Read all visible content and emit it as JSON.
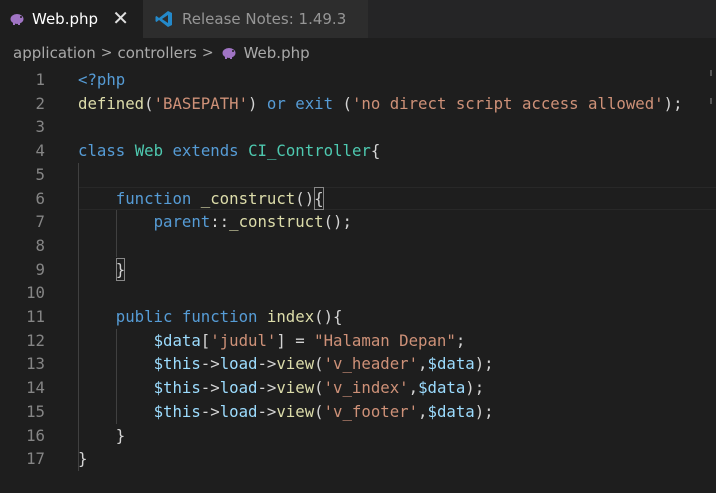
{
  "tabs": [
    {
      "label": "Web.php",
      "icon": "php-elephant-icon",
      "active": true
    },
    {
      "label": "Release Notes: 1.49.3",
      "icon": "vscode-icon",
      "active": false
    }
  ],
  "tab_close_glyph": "✕",
  "breadcrumb": {
    "items": [
      "application",
      "controllers"
    ],
    "separator": ">",
    "file": "Web.php",
    "file_icon": "php-elephant-icon"
  },
  "colors": {
    "background": "#1e1e1e",
    "keyword": "#569cd6",
    "function": "#dcdcaa",
    "string": "#ce9178",
    "class": "#4ec9b0",
    "variable": "#9cdcfe",
    "php_icon": "#a074c4",
    "vscode_icon": "#2489ca"
  },
  "lines": [
    {
      "n": "1",
      "tokens": [
        {
          "t": "<?php",
          "c": "kw"
        }
      ]
    },
    {
      "n": "2",
      "tokens": [
        {
          "t": "defined",
          "c": "fn"
        },
        {
          "t": "(",
          "c": "txt"
        },
        {
          "t": "'BASEPATH'",
          "c": "str"
        },
        {
          "t": ") ",
          "c": "txt"
        },
        {
          "t": "or",
          "c": "kw"
        },
        {
          "t": " ",
          "c": "txt"
        },
        {
          "t": "exit",
          "c": "kw"
        },
        {
          "t": " (",
          "c": "txt"
        },
        {
          "t": "'no direct script access allowed'",
          "c": "str"
        },
        {
          "t": ");",
          "c": "txt"
        }
      ]
    },
    {
      "n": "3",
      "tokens": []
    },
    {
      "n": "4",
      "tokens": [
        {
          "t": "class",
          "c": "kw"
        },
        {
          "t": " ",
          "c": "txt"
        },
        {
          "t": "Web",
          "c": "cls"
        },
        {
          "t": " ",
          "c": "txt"
        },
        {
          "t": "extends",
          "c": "kw"
        },
        {
          "t": " ",
          "c": "txt"
        },
        {
          "t": "CI_Controller",
          "c": "cls"
        },
        {
          "t": "{",
          "c": "txt"
        }
      ]
    },
    {
      "n": "5",
      "tokens": []
    },
    {
      "n": "6",
      "tokens": [
        {
          "t": "    ",
          "c": "txt"
        },
        {
          "t": "function",
          "c": "kw"
        },
        {
          "t": " ",
          "c": "txt"
        },
        {
          "t": "_construct",
          "c": "fn"
        },
        {
          "t": "()",
          "c": "txt"
        },
        {
          "t": "{",
          "c": "txt",
          "box": true
        }
      ]
    },
    {
      "n": "7",
      "tokens": [
        {
          "t": "        ",
          "c": "txt"
        },
        {
          "t": "parent",
          "c": "kw"
        },
        {
          "t": "::",
          "c": "txt"
        },
        {
          "t": "_construct",
          "c": "fn"
        },
        {
          "t": "();",
          "c": "txt"
        }
      ]
    },
    {
      "n": "8",
      "tokens": []
    },
    {
      "n": "9",
      "tokens": [
        {
          "t": "    ",
          "c": "txt"
        },
        {
          "t": "}",
          "c": "txt",
          "box": true
        }
      ]
    },
    {
      "n": "10",
      "tokens": []
    },
    {
      "n": "11",
      "tokens": [
        {
          "t": "    ",
          "c": "txt"
        },
        {
          "t": "public",
          "c": "kw"
        },
        {
          "t": " ",
          "c": "txt"
        },
        {
          "t": "function",
          "c": "kw"
        },
        {
          "t": " ",
          "c": "txt"
        },
        {
          "t": "index",
          "c": "fn"
        },
        {
          "t": "(){",
          "c": "txt"
        }
      ]
    },
    {
      "n": "12",
      "tokens": [
        {
          "t": "        ",
          "c": "txt"
        },
        {
          "t": "$data",
          "c": "var"
        },
        {
          "t": "[",
          "c": "txt"
        },
        {
          "t": "'judul'",
          "c": "str"
        },
        {
          "t": "] = ",
          "c": "txt"
        },
        {
          "t": "\"Halaman Depan\"",
          "c": "str"
        },
        {
          "t": ";",
          "c": "txt"
        }
      ]
    },
    {
      "n": "13",
      "tokens": [
        {
          "t": "        ",
          "c": "txt"
        },
        {
          "t": "$this",
          "c": "var"
        },
        {
          "t": "->",
          "c": "txt"
        },
        {
          "t": "load",
          "c": "var"
        },
        {
          "t": "->",
          "c": "txt"
        },
        {
          "t": "view",
          "c": "fn"
        },
        {
          "t": "(",
          "c": "txt"
        },
        {
          "t": "'v_header'",
          "c": "str"
        },
        {
          "t": ",",
          "c": "txt"
        },
        {
          "t": "$data",
          "c": "var"
        },
        {
          "t": ");",
          "c": "txt"
        }
      ]
    },
    {
      "n": "14",
      "tokens": [
        {
          "t": "        ",
          "c": "txt"
        },
        {
          "t": "$this",
          "c": "var"
        },
        {
          "t": "->",
          "c": "txt"
        },
        {
          "t": "load",
          "c": "var"
        },
        {
          "t": "->",
          "c": "txt"
        },
        {
          "t": "view",
          "c": "fn"
        },
        {
          "t": "(",
          "c": "txt"
        },
        {
          "t": "'v_index'",
          "c": "str"
        },
        {
          "t": ",",
          "c": "txt"
        },
        {
          "t": "$data",
          "c": "var"
        },
        {
          "t": ");",
          "c": "txt"
        }
      ]
    },
    {
      "n": "15",
      "tokens": [
        {
          "t": "        ",
          "c": "txt"
        },
        {
          "t": "$this",
          "c": "var"
        },
        {
          "t": "->",
          "c": "txt"
        },
        {
          "t": "load",
          "c": "var"
        },
        {
          "t": "->",
          "c": "txt"
        },
        {
          "t": "view",
          "c": "fn"
        },
        {
          "t": "(",
          "c": "txt"
        },
        {
          "t": "'v_footer'",
          "c": "str"
        },
        {
          "t": ",",
          "c": "txt"
        },
        {
          "t": "$data",
          "c": "var"
        },
        {
          "t": ");",
          "c": "txt"
        }
      ]
    },
    {
      "n": "16",
      "tokens": [
        {
          "t": "    ",
          "c": "txt"
        },
        {
          "t": "}",
          "c": "txt"
        }
      ]
    },
    {
      "n": "17",
      "tokens": [
        {
          "t": "}",
          "c": "txt"
        }
      ]
    }
  ]
}
